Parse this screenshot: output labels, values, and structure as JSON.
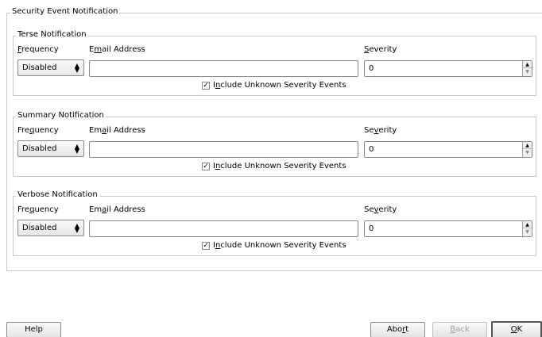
{
  "outer_group": {
    "title": "Security Event Notification"
  },
  "labels": {
    "frequency": "Frequency",
    "email": "Email Address",
    "severity": "Severity",
    "include_unknown": "Include Unknown Severity Events"
  },
  "sections": [
    {
      "title": "Terse Notification",
      "frequency": "Disabled",
      "email": "",
      "severity": "0",
      "include_unknown": true
    },
    {
      "title": "Summary Notification",
      "frequency": "Disabled",
      "email": "",
      "severity": "0",
      "include_unknown": true
    },
    {
      "title": "Verbose Notification",
      "frequency": "Disabled",
      "email": "",
      "severity": "0",
      "include_unknown": true
    }
  ],
  "buttons": {
    "help": "Help",
    "abort": "Abort",
    "back": "Back",
    "ok": "OK"
  },
  "icons": {
    "combo_arrow": "up-down-arrow-icon",
    "spin_up": "spin-up-icon",
    "spin_down": "spin-down-icon",
    "check": "checkmark-icon"
  }
}
